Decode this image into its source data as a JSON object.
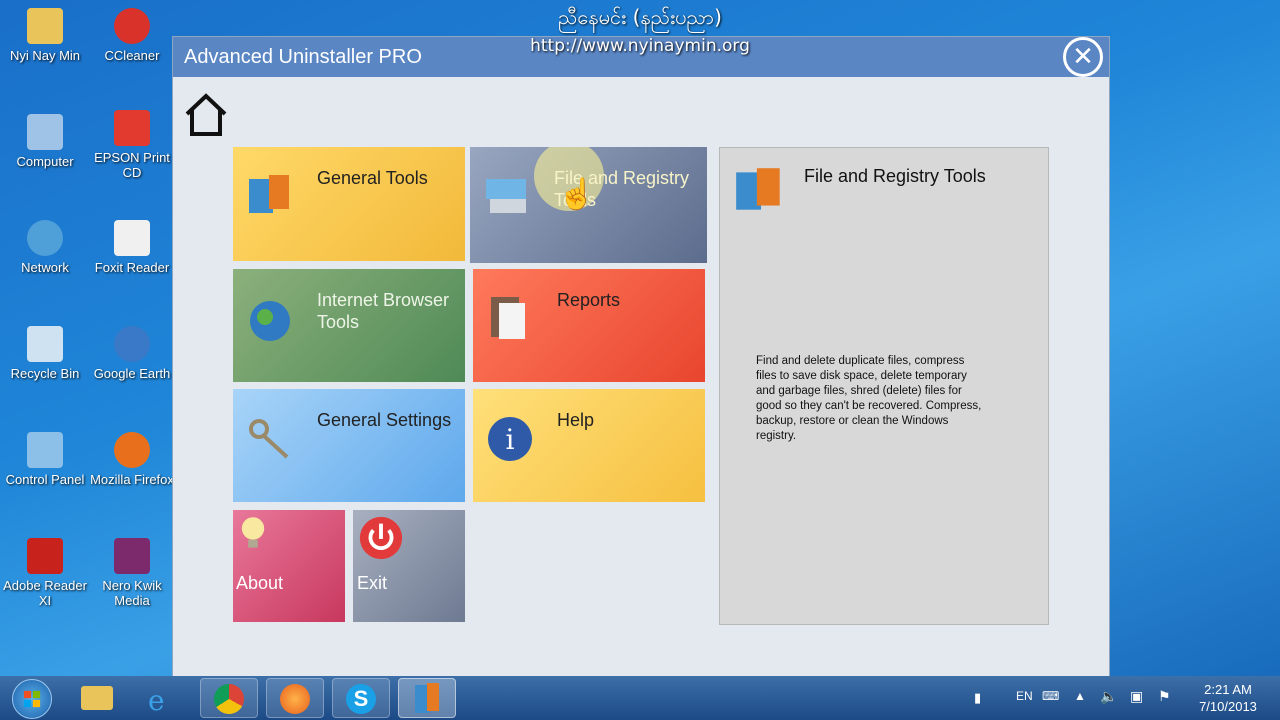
{
  "overlay": {
    "burmese": "ညီနေမင်း (နည်းပညာ)",
    "url": "http://www.nyinaymin.org"
  },
  "desktop": {
    "icons": [
      {
        "label": "Nyi Nay Min"
      },
      {
        "label": "CCleaner"
      },
      {
        "label": "Computer"
      },
      {
        "label": "EPSON Print CD"
      },
      {
        "label": "Network"
      },
      {
        "label": "Foxit Reader"
      },
      {
        "label": "Recycle Bin"
      },
      {
        "label": "Google Earth"
      },
      {
        "label": "Control Panel"
      },
      {
        "label": "Mozilla Firefox"
      },
      {
        "label": "Adobe Reader XI"
      },
      {
        "label": "Nero Kwik Media"
      }
    ]
  },
  "window": {
    "title": "Advanced Uninstaller PRO",
    "close": "✕"
  },
  "tiles": [
    {
      "label": "General Tools"
    },
    {
      "label": "File and Registry Tools"
    },
    {
      "label": "Internet Browser Tools"
    },
    {
      "label": "Reports"
    },
    {
      "label": "General Settings"
    },
    {
      "label": "Help"
    },
    {
      "label": "About"
    },
    {
      "label": "Exit"
    }
  ],
  "panel": {
    "title": "File and Registry Tools",
    "description": "Find and delete duplicate files, compress files to save disk space, delete temporary and garbage files, shred (delete) files for good so they can't be recovered. Compress, backup, restore or clean the Windows registry."
  },
  "taskbar": {
    "lang": "EN",
    "time": "2:21 AM",
    "date": "7/10/2013"
  },
  "colors": {
    "general_tools": "#f6c94e",
    "file_registry": "#7a8aa8",
    "internet": "#6e9c6a",
    "reports": "#f06048",
    "settings": "#79b7ee",
    "help": "#f8cf58",
    "about": "#d9567a",
    "exit": "#8e98ac"
  }
}
